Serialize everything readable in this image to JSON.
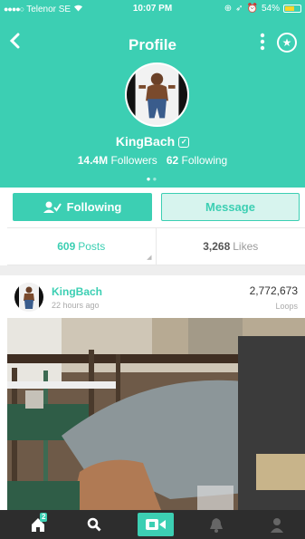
{
  "status_bar": {
    "carrier": "Telenor SE",
    "time": "10:07 PM",
    "battery": "54%"
  },
  "nav": {
    "title": "Profile"
  },
  "profile": {
    "name": "KingBach",
    "followers_count": "14.4M",
    "followers_label": "Followers",
    "following_count": "62",
    "following_label": "Following"
  },
  "actions": {
    "following_label": "Following",
    "message_label": "Message"
  },
  "stats": {
    "posts_count": "609",
    "posts_label": "Posts",
    "likes_count": "3,268",
    "likes_label": "Likes"
  },
  "post": {
    "user": "KingBach",
    "time": "22 hours ago",
    "loops_count": "2,772,673",
    "loops_label": "Loops"
  },
  "tabbar": {
    "home_badge": "2"
  },
  "colors": {
    "accent": "#3ccfb3",
    "tabbar": "#2d2d2d"
  },
  "icons": [
    "back-chevron-icon",
    "more-vertical-icon",
    "star-circle-icon",
    "verified-icon",
    "follow-check-icon",
    "home-icon",
    "search-icon",
    "record-camera-icon",
    "notifications-bell-icon",
    "profile-person-icon"
  ]
}
